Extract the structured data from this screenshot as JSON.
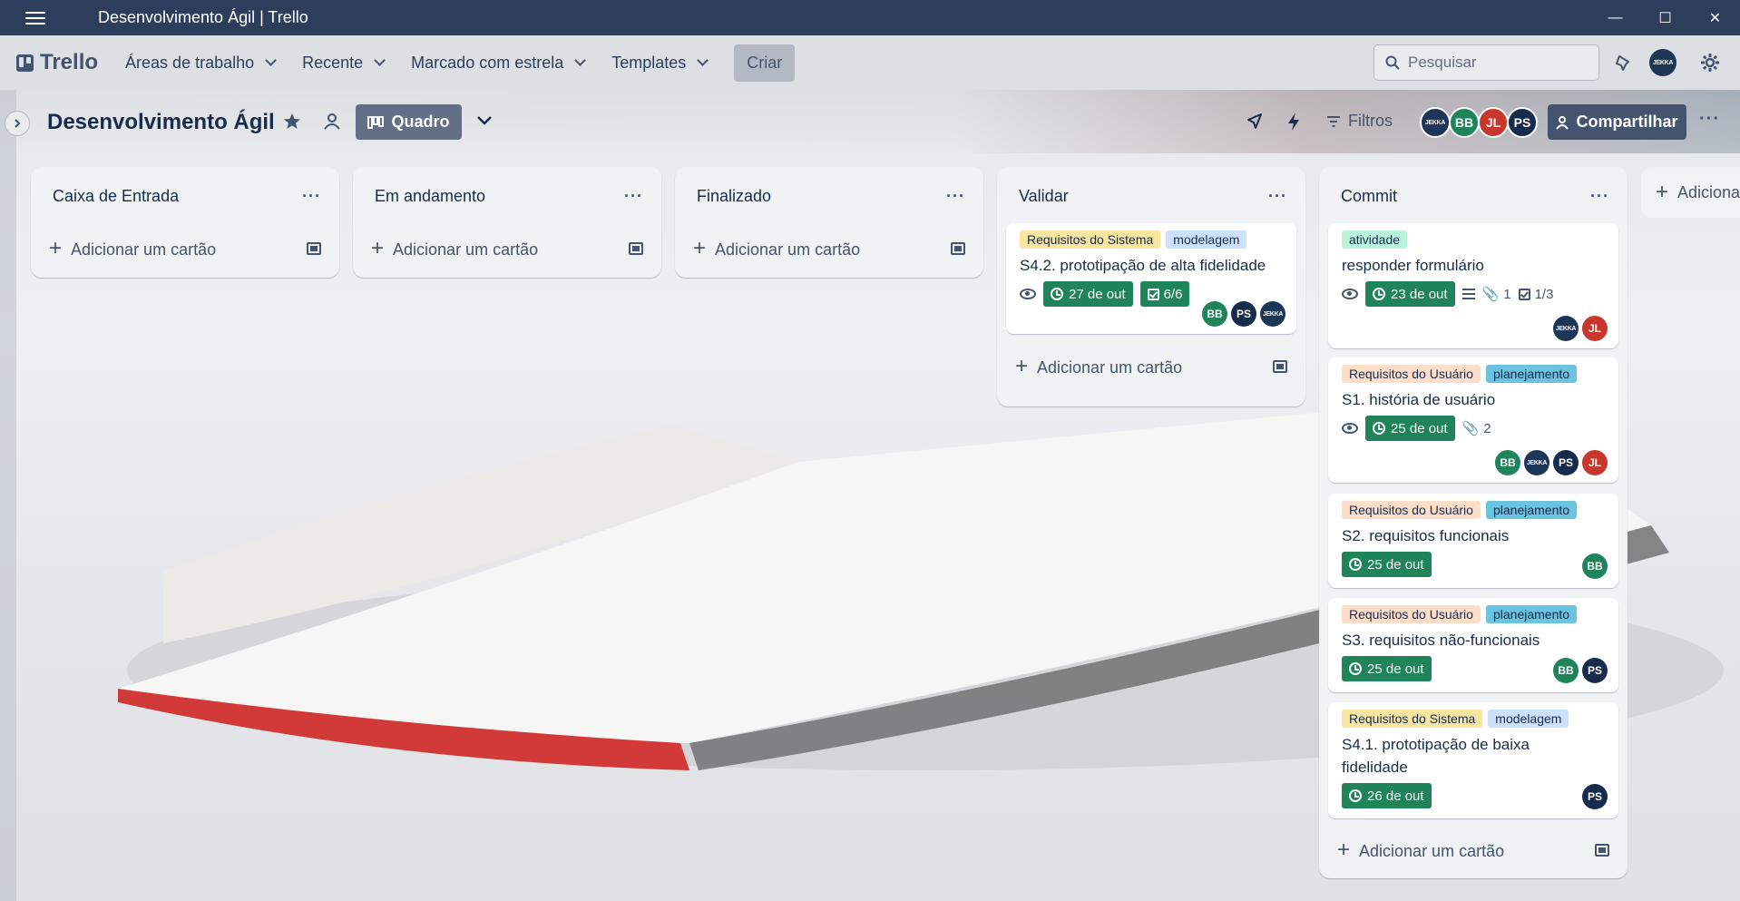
{
  "window": {
    "title": "Desenvolvimento Ágil | Trello",
    "minimize": "—",
    "maximize": "☐",
    "close": "✕"
  },
  "header": {
    "logo": "Trello",
    "nav": [
      "Áreas de trabalho",
      "Recente",
      "Marcado com estrela",
      "Templates"
    ],
    "create": "Criar",
    "search_placeholder": "Pesquisar",
    "user_avatar": "JEKKA"
  },
  "board": {
    "title": "Desenvolvimento Ágil",
    "view": "Quadro",
    "filters": "Filtros",
    "share": "Compartilhar",
    "members": [
      "JEKKA",
      "BB",
      "JL",
      "PS"
    ],
    "add_list": "Adicionar"
  },
  "lists": [
    {
      "name": "Caixa de Entrada",
      "add": "Adicionar um cartão"
    },
    {
      "name": "Em andamento",
      "add": "Adicionar um cartão"
    },
    {
      "name": "Finalizado",
      "add": "Adicionar um cartão"
    },
    {
      "name": "Validar",
      "add": "Adicionar um cartão",
      "cards": [
        {
          "labels": [
            "Requisitos do Sistema",
            "modelagem"
          ],
          "title": "S4.2. prototipação de alta fidelidade",
          "due": "27 de out",
          "checklist": "6/6",
          "members": [
            "BB",
            "PS",
            "JEKKA"
          ]
        }
      ]
    },
    {
      "name": "Commit",
      "add": "Adicionar um cartão",
      "cards": [
        {
          "labels": [
            "atividade"
          ],
          "title": "responder formulário",
          "due": "23 de out",
          "attachments": "1",
          "checklist": "1/3",
          "members": [
            "JEKKA",
            "JL"
          ]
        },
        {
          "labels": [
            "Requisitos do Usuário",
            "planejamento"
          ],
          "title": "S1. história de usuário",
          "due": "25 de out",
          "attachments": "2",
          "members": [
            "BB",
            "JEKKA",
            "PS",
            "JL"
          ]
        },
        {
          "labels": [
            "Requisitos do Usuário",
            "planejamento"
          ],
          "title": "S2. requisitos funcionais",
          "due": "25 de out",
          "members": [
            "BB"
          ]
        },
        {
          "labels": [
            "Requisitos do Usuário",
            "planejamento"
          ],
          "title": "S3. requisitos não-funcionais",
          "due": "25 de out",
          "members": [
            "BB",
            "PS"
          ]
        },
        {
          "labels": [
            "Requisitos do Sistema",
            "modelagem"
          ],
          "title": "S4.1. prototipação de baixa fidelidade",
          "due": "26 de out",
          "members": [
            "PS"
          ]
        }
      ]
    }
  ],
  "colors": {
    "due_green": "#1f845a",
    "header_dark": "#2c3e5c",
    "label_sistema": "#f8e6a0",
    "label_usuario": "#fedec8",
    "label_modelagem": "#cce0ff",
    "label_planejamento": "#6cc3e0",
    "label_atividade": "#baf3db"
  }
}
